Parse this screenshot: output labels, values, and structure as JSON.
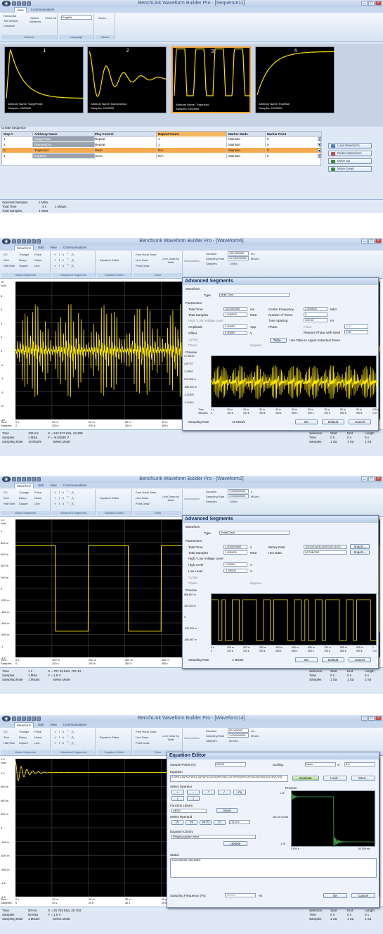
{
  "app_name": "BenchLink Waveform Builder Pro",
  "shot1": {
    "title": "BenchLink Waveform Builder Pro - [Sequence11]",
    "tabs": [
      "View",
      "Communications"
    ],
    "ribbon": {
      "window_items": [
        "Horizontal",
        "Tile Vertical",
        "Cascade"
      ],
      "switch_windows": "Switch Windows",
      "close_all": "Close All",
      "language_value": "English",
      "about": "About...",
      "groups": [
        "Window",
        "Language",
        "About"
      ]
    },
    "panes": [
      {
        "num": "1",
        "name": "Arbitrary Name: SurgePulse",
        "samples": "Samples: 1000000"
      },
      {
        "num": "2",
        "name": "Arbitrary Name: DampedOsc",
        "samples": "Samples: 1000000"
      },
      {
        "num": "3",
        "name": "Arbitrary Name: Trapezoid",
        "samples": "Samples: 1000000"
      },
      {
        "num": "4",
        "name": "Arbitrary Name: ExpRise",
        "samples": "Samples: 1000000"
      }
    ],
    "create_sequence_label": "Create Sequence",
    "table": {
      "headers": [
        "Step #",
        "Arbitrary Name",
        "Play Control",
        "Repeat Count",
        "Marker Mode",
        "Marker Point"
      ],
      "rows": [
        [
          "1",
          "SurgePulse",
          "Repeat",
          "1",
          "Maintain",
          "0"
        ],
        [
          "2",
          "DampedOsc",
          "Repeat",
          "1",
          "Maintain",
          "0"
        ],
        [
          "3",
          "Trapezoid",
          "Once",
          "N/A",
          "Maintain",
          "0"
        ],
        [
          "4",
          "ExpRise",
          "Once",
          "N/A",
          "Maintain",
          "0"
        ]
      ]
    },
    "side_buttons": [
      "Load Waveform",
      "Delete Waveform",
      "Move Up",
      "Move Down"
    ],
    "status": {
      "labels": [
        "Selected Samples",
        "Total Time",
        "Total Samples"
      ],
      "values": [
        "1 MSa",
        "4 s",
        "4 MSa"
      ],
      "extra": "1 MSa/s"
    }
  },
  "shared_ribbon": {
    "tabs": [
      "Waveform",
      "Edit",
      "View",
      "Communications"
    ],
    "basic": [
      "DC",
      "Triangle",
      "Pulse",
      "Sine",
      "Ramp",
      "Noise",
      "Half Sine",
      "Square",
      "Line"
    ],
    "equation_editor": "Equation Editor",
    "draw": [
      "Free Hand Draw",
      "Line Draw",
      "Point Draw"
    ],
    "line_draw_table": "Line Draw by Table",
    "interpolation": "Interpolation",
    "duration_label": "Duration",
    "sampling_rate_label": "Sampling Rate",
    "samples_label": "Samples",
    "groups": [
      "Basic Segments",
      "Advanced Segments",
      "Equation Editor",
      "Draw"
    ]
  },
  "shot2": {
    "title": "BenchLink Waveform Builder Pro - [Waveform6]",
    "duration": "100.000000",
    "duration_unit": "ms",
    "sampling_rate": "10.000000000",
    "sampling_unit": "MSa/s",
    "samples": "1 MSa",
    "y_ticks": [
      "10",
      "8",
      "6",
      "4",
      "2",
      "0",
      "-2",
      "-4",
      "-6",
      "-8",
      "-10"
    ],
    "y_unit": "Volts",
    "x_ticks_time": [
      "0 s",
      "10 m",
      "20 m",
      "30 m",
      "40 m"
    ],
    "x_ticks_samples": [
      "0",
      "100 k",
      "200 k",
      "300 k",
      "400 k"
    ],
    "x_row_labels": [
      "Time",
      "Samples"
    ],
    "dialog": {
      "title": "Advanced Segments",
      "waveform_label": "Waveform",
      "type_label": "Type",
      "type_value": "Multi-Tone",
      "parameters_label": "Parameters",
      "total_time_label": "Total Time",
      "total_time": "100.000000",
      "total_time_unit": "ms",
      "total_samples_label": "Total Samples",
      "total_samples": "1.000000",
      "total_samples_unit": "MSa",
      "hi_lo_label": "High / Low Voltage Level",
      "amplitude_label": "Amplitude",
      "amplitude": "2.00000",
      "amplitude_unit": "Vpp",
      "offset_label": "Offset",
      "offset": "0.00000",
      "offset_unit": "V",
      "cycles_label": "Cycles",
      "phase_label": "Phase",
      "phase_unit": "degrees",
      "center_freq_label": "Center Frequency",
      "center_freq": "2.000000",
      "center_freq_unit": "MHz",
      "num_tones_label": "Number of Tones",
      "num_tones": "6",
      "tone_spacing_label": "Tone Spacing",
      "tone_spacing": "100.00",
      "tone_spacing_unit": "Hz",
      "phase2_label": "Phase",
      "fixed_label": "Fixed",
      "fixed_value": "0.00",
      "random_label": "Random Phase with Seed",
      "seed": "1.00",
      "table_btn": "Table...",
      "table_hint": "Use Table to Adjust Individual Tones",
      "preview_label": "Preview",
      "preview_y": [
        "0.738213",
        "2.57727",
        "1.42852",
        "270.306 m",
        "-888.504 m",
        "-2.81803",
        "-3.41419"
      ],
      "preview_x": [
        "0 s",
        "10 m",
        "20 m",
        "30 m",
        "40 m",
        "50 m",
        "60 m",
        "70 m",
        "80 m",
        "90 m",
        "100 m"
      ],
      "preview_xs": [
        "0",
        "100 k",
        "200 k",
        "300 k",
        "400 k",
        "500 k",
        "600 k",
        "700 k",
        "800 k",
        "900 k",
        "1 M"
      ],
      "preview_row_labels": [
        "Time",
        "Samples"
      ],
      "sampling_rate_label": "Sampling Rate",
      "sampling_rate": "10 MSa/s",
      "ok": "OK",
      "default": "Default",
      "cancel": "Cancel"
    },
    "status": {
      "labels": [
        "Time",
        "Samples",
        "Sampling Rate"
      ],
      "values": [
        "100 ms",
        "1 MSa",
        "10 MSa/s"
      ],
      "cursor_x": "X = 242.977 kSa, 24.298",
      "cursor_y": "Y = -9.02549 V",
      "mode": "Select Mode",
      "sel_headers": [
        "Selection",
        "Start",
        "End",
        "Length"
      ],
      "sel_time": [
        "Time",
        "0 s",
        "0 s",
        "0 s"
      ],
      "sel_samples": [
        "Samples",
        "1 Sa",
        "1 Sa",
        "1 Sa"
      ]
    }
  },
  "shot3": {
    "title": "BenchLink Waveform Builder Pro - [Waveform2]",
    "duration": "1.000000000",
    "duration_unit": "s",
    "sampling_rate": "1.000000000",
    "sampling_unit": "MSa/s",
    "samples": "1 MSa",
    "y_ticks": [
      "1.2",
      "1",
      "800 m",
      "600 m",
      "400 m",
      "200 m",
      "0",
      "-200 m",
      "-400 m",
      "-600 m",
      "-800 m",
      "-1",
      "-1.2"
    ],
    "y_unit": "Volts",
    "x_ticks_time": [
      "0 s",
      "100 m",
      "200 m",
      "300 m",
      "400 m"
    ],
    "x_ticks_samples": [
      "0",
      "100 k",
      "200 k",
      "300 k",
      "400 k"
    ],
    "dialog": {
      "title": "Advanced Segments",
      "waveform_label": "Waveform",
      "type_label": "Type",
      "type_value": "Serial Data",
      "parameters_label": "Parameters",
      "total_time_label": "Total Time",
      "total_time": "1.000000000",
      "total_time_unit": "s",
      "total_samples_label": "Total Samples",
      "total_samples": "1.000000",
      "total_samples_unit": "MSa",
      "hi_lo_label": "High / Low Voltage Level",
      "high_label": "High Level",
      "high": "1.00000",
      "high_unit": "V",
      "low_label": "Low Level",
      "low": "-1.00000",
      "low_unit": "V",
      "cycles_label": "Cycles",
      "phase_label": "Phase",
      "phase_unit": "degrees",
      "binary_label": "Binary Data",
      "binary": "110100110111100110111100",
      "hex_label": "Hex Data",
      "hex": "D379BCBE",
      "import": "Import...",
      "preview_label": "Preview",
      "preview_y": [
        "666.667 m",
        "333.333 m",
        "0",
        "-333.333 m",
        "-666.667 m"
      ],
      "preview_x": [
        "0 s",
        "100 m",
        "200 m",
        "300 m",
        "400 m",
        "500 m",
        "600 m",
        "700 m",
        "800 m",
        "900 m",
        "1"
      ],
      "preview_xs": [
        "0",
        "100 k",
        "200 k",
        "300 k",
        "400 k",
        "500 k",
        "600 k",
        "700 k",
        "800 k",
        "900 k",
        "1 M"
      ],
      "sampling_rate_label": "Sampling Rate",
      "sampling_rate": "1 MSa/s",
      "ok": "OK",
      "default": "Default",
      "cancel": "Cancel"
    },
    "status": {
      "labels": [
        "Time",
        "Samples",
        "Sampling Rate"
      ],
      "values": [
        "1 s",
        "1 MSa",
        "1 MSa/s"
      ],
      "cursor_x": "X = 767.13 kSa, 767.13",
      "cursor_y": "Y = 1.5 V",
      "mode": "Select Mode",
      "sel_headers": [
        "Selection",
        "Start",
        "End",
        "Length"
      ],
      "sel_time": [
        "Time",
        "0 s",
        "0 s",
        "0 s"
      ],
      "sel_samples": [
        "Samples",
        "1 Sa",
        "1 Sa",
        "1 Sa"
      ]
    }
  },
  "shot4": {
    "title": "BenchLink Waveform Builder Pro - [Waveform14]",
    "duration": "50.000000",
    "duration_unit": "ms",
    "sampling_rate": "1.000000000",
    "sampling_unit": "MSa/s",
    "samples": "50 kSa",
    "y_ticks": [
      "1.5",
      "1.2",
      "900 m",
      "600 m",
      "300 m",
      "0",
      "-300 m",
      "-600 m",
      "-900 m",
      "-1.2",
      "-1.5"
    ],
    "y_unit": "Volts",
    "x_ticks_time": [
      "0 s",
      "10 m",
      "20 m",
      "30 m",
      "40 m"
    ],
    "x_ticks_samples": [
      "0",
      "10 k",
      "20 k",
      "30 k",
      "40 k"
    ],
    "dialog": {
      "title": "Equation Editor",
      "sample_points_label": "Sample Points (X):",
      "sample_points": "50000",
      "scaling_label": "Scaling:",
      "scaling": "None",
      "v_label": "V:",
      "v_value": "5.0",
      "equation_label": "Equation",
      "equation": "STEP((X-[X]*N-2*DIV(1-[X]*[1])*SC(COS((PI*(X/(N-1)-STEP(X/[X]*N-2)*PI(COS(0)*[X]*(X-[X])*(X+2)))",
      "evaluate": "Evaluate",
      "load": "Load...",
      "save": "Save...",
      "select_operator_label": "Select Operator",
      "operators": [
        "+",
        "-",
        "*",
        "/",
        "x^y",
        "(",
        ")"
      ],
      "function_library_label": "Function Library",
      "function": "ABS()",
      "insert": "Insert",
      "select_operand_label": "Select Operand",
      "operands": [
        "[X]",
        "[N]",
        "Var [X]",
        "[T]"
      ],
      "operand_value": "[T]: 0.5",
      "equation_library_label": "Equation Library",
      "equation_library": "Ringing square wave",
      "update": "Update",
      "preview_label": "Preview",
      "preview_y": [
        "1.20",
        "251.60 mVolts",
        "-1.20"
      ],
      "preview_x": [
        "0.000 s",
        "50.000 ms"
      ],
      "status_label": "Status",
      "status_text": "Successfully calculated",
      "sampling_freq_label": "Sampling Frequency (Fs):",
      "sampling_freq": "100000",
      "sampling_freq_unit": "Hz",
      "ok": "OK",
      "cancel": "Cancel"
    },
    "status": {
      "labels": [
        "Time",
        "Samples",
        "Sampling Rate"
      ],
      "values": [
        "50 ms",
        "50 kSa",
        "1 MSa/s"
      ],
      "cursor_x": "X = 25.754 kSa, 25.754",
      "cursor_y": "Y = 1.5 V",
      "mode": "Select Mode",
      "sel_headers": [
        "Selection",
        "Start",
        "End",
        "Length"
      ],
      "sel_time": [
        "Time",
        "0 s",
        "0 s",
        "0 s"
      ],
      "sel_samples": [
        "Samples",
        "1 Sa",
        "1 Sa",
        "1 Sa"
      ]
    }
  }
}
